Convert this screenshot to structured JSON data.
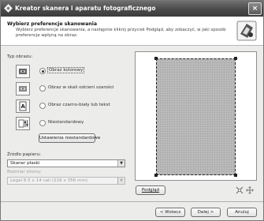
{
  "window": {
    "title": "Kreator skanera i aparatu fotograficznego",
    "close_glyph": "×"
  },
  "header": {
    "title": "Wybierz preferencje skanowania",
    "description": "Wybierz preferencje skanowania, a następnie kliknij przycisk Podgląd, aby zobaczyć, w jaki sposób preferencje wpłyną na obraz."
  },
  "picture_type": {
    "label": "Typ obrazu:",
    "options": [
      {
        "label": "Obraz kolorowy",
        "checked": true
      },
      {
        "label": "Obraz w skali odcieni szarości",
        "checked": false
      },
      {
        "label": "Obraz czarno-biały lub tekst",
        "checked": false
      },
      {
        "label": "Niestandardowy",
        "checked": false
      }
    ],
    "custom_settings_button": "Ustawienia niestandardowe"
  },
  "paper_source": {
    "label": "Źródło papieru:",
    "value": "Skaner płaski"
  },
  "page_size": {
    "label": "Rozmiar strony:",
    "value": "Legal 8.5 x 14 cali (216 x 356 mm)"
  },
  "preview": {
    "button_label": "Podgląd",
    "zoom_icons": [
      "fit-icon",
      "enlarge-icon"
    ]
  },
  "footer": {
    "back_label": "< Wstecz",
    "next_label": "Dalej >",
    "cancel_label": "Anuluj"
  },
  "colors": {
    "titlebar": "#4a4a4a",
    "header_bg": "#ffffff",
    "window_bg": "#ececea",
    "scan_area": "#b9b9b9"
  }
}
